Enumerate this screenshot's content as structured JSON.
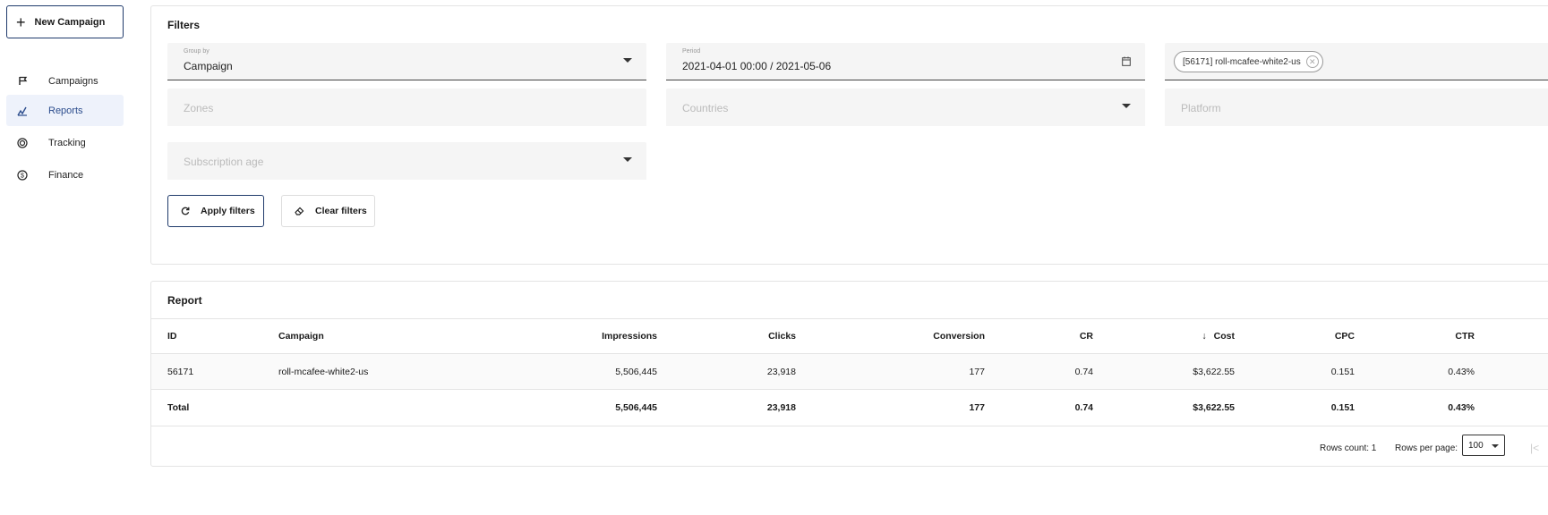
{
  "sidebar": {
    "new_campaign_label": "New Campaign",
    "items": [
      {
        "label": "Campaigns",
        "icon": "flag-icon"
      },
      {
        "label": "Reports",
        "icon": "chart-icon",
        "active": true
      },
      {
        "label": "Tracking",
        "icon": "target-icon"
      },
      {
        "label": "Finance",
        "icon": "dollar-icon"
      }
    ]
  },
  "filters": {
    "title": "Filters",
    "group_by": {
      "label": "Group by",
      "value": "Campaign"
    },
    "period": {
      "label": "Period",
      "value": "2021-04-01 00:00 / 2021-05-06"
    },
    "campaign_chip": "[56171] roll-mcafee-white2-us",
    "zones_placeholder": "Zones",
    "countries_placeholder": "Countries",
    "platform_placeholder": "Platform",
    "subscription_age_placeholder": "Subscription age",
    "apply_label": "Apply filters",
    "clear_label": "Clear filters"
  },
  "report": {
    "title": "Report",
    "columns": {
      "id": "ID",
      "campaign": "Campaign",
      "impressions": "Impressions",
      "clicks": "Clicks",
      "conversion": "Conversion",
      "cr": "CR",
      "cost": "Cost",
      "cpc": "CPC",
      "ctr": "CTR"
    },
    "rows": [
      {
        "id": "56171",
        "campaign": "roll-mcafee-white2-us",
        "impressions": "5,506,445",
        "clicks": "23,918",
        "conversion": "177",
        "cr": "0.74",
        "cost": "$3,622.55",
        "cpc": "0.151",
        "ctr": "0.43%"
      }
    ],
    "total": {
      "label": "Total",
      "impressions": "5,506,445",
      "clicks": "23,918",
      "conversion": "177",
      "cr": "0.74",
      "cost": "$3,622.55",
      "cpc": "0.151",
      "ctr": "0.43%"
    },
    "footer": {
      "rows_count": "Rows count: 1",
      "rows_per_page_label": "Rows per page:",
      "rows_per_page_value": "100"
    }
  },
  "colors": {
    "accent": "#1f3a6b",
    "active_bg": "#eef2fb"
  }
}
